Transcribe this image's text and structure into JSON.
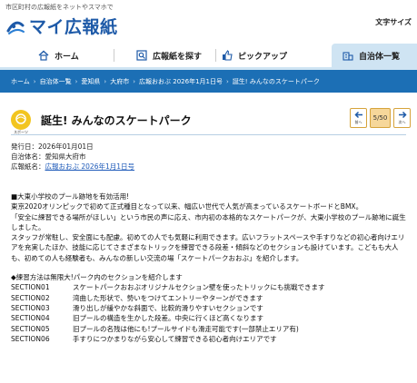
{
  "header": {
    "tagline": "市区町村の広報紙をネットやスマホで",
    "logo_text": "マイ広報紙",
    "font_size_label": "文字サイズ"
  },
  "nav": {
    "items": [
      {
        "label": "ホーム",
        "icon": "home-icon"
      },
      {
        "label": "広報紙を探す",
        "icon": "search-icon"
      },
      {
        "label": "ピックアップ",
        "icon": "thumbs-up-icon"
      },
      {
        "label": "自治体一覧",
        "icon": "building-icon"
      }
    ],
    "active_index": 3
  },
  "breadcrumb": [
    "ホーム",
    "自治体一覧",
    "愛知県",
    "大府市",
    "広報おおぶ 2026年1月1日号",
    "誕生! みんなのスケートパーク"
  ],
  "article": {
    "icon_caption": "スポーツ",
    "title": "誕生! みんなのスケートパーク",
    "pager": {
      "prev_label": "前へ",
      "page": "5/50",
      "next_label": "次へ"
    },
    "meta": {
      "published": "発行日：2026年01月01日",
      "municipality": "自治体名：愛知県大府市",
      "issue_label": "広報紙名：",
      "issue_link": "広報おおぶ 2026年1月1日号"
    },
    "paragraphs": [
      "■大東小学校のプール跡地を有効活用!",
      "東京2020オリンピックで初めて正式種目となって以来、幅広い世代で人気が高まっているスケートボードとBMX。",
      "「安全に練習できる場所がほしい」という市民の声に応え、市内初の本格的なスケートパークが、大東小学校のプール跡地に誕生しました。",
      "スタッフが常駐し、安全面にも配慮。初めての人でも気軽に利用できます。広いフラットスペースや手すりなどの初心者向けエリアを充実したほか、技能に応じてさまざまなトリックを練習できる段差・傾斜などのセクションも設けています。こどもも大人も、初めての人も経験者も、みんなの新しい交流の場「スケートパークおおぶ」を紹介します。"
    ],
    "sections_intro": "◆練習方法は無限大!パーク内のセクションを紹介します",
    "sections": [
      {
        "id": "SECTION01",
        "text": "スケートパークおおぶオリジナルセクション壁を使ったトリックにも挑戦できます"
      },
      {
        "id": "SECTION02",
        "text": "湾曲した形状で、勢いをつけてエントリーやターンができます"
      },
      {
        "id": "SECTION03",
        "text": "滑り出しが緩やかな斜面で、比較的滑りやすいセクションです"
      },
      {
        "id": "SECTION04",
        "text": "旧プールの構造を生かした段差。中央に行くほど高くなります"
      },
      {
        "id": "SECTION05",
        "text": "旧プールの名残は他にも!プールサイドも滑走可能です(一部禁止エリア有)"
      },
      {
        "id": "SECTION06",
        "text": "手すりにつかまりながら安心して練習できる初心者向けエリアです"
      }
    ]
  },
  "colors": {
    "brand_blue": "#1e5aa8",
    "breadcrumb_bg": "#1c6fb5",
    "nav_active_bg": "#cfe4f3",
    "category_icon": "#f2c51f",
    "pager_border": "#d6a33b"
  }
}
